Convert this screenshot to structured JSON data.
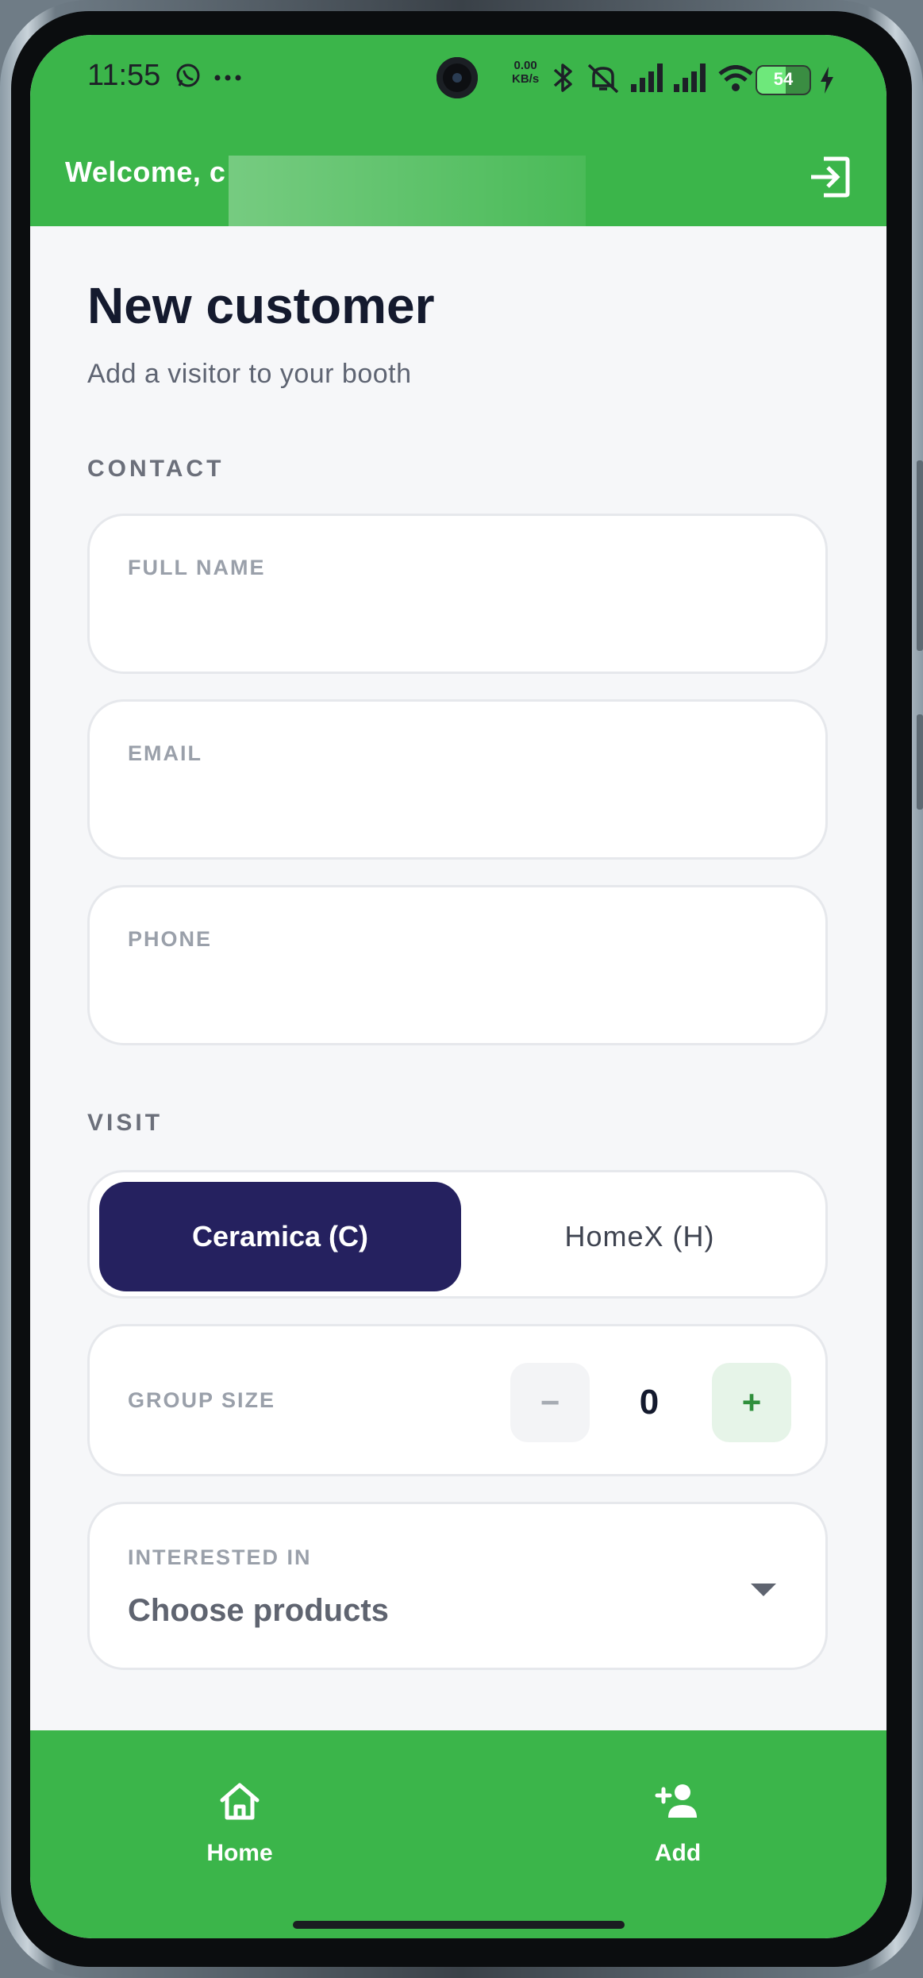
{
  "status_bar": {
    "time": "11:55",
    "net_speed_value": "0.00",
    "net_speed_unit": "KB/s",
    "battery_level": "54",
    "icons": [
      "whatsapp-icon",
      "more-icon",
      "bluetooth-icon",
      "mute-icon",
      "signal-icon",
      "signal-icon",
      "wifi-icon",
      "battery-icon",
      "charging-icon"
    ]
  },
  "header": {
    "welcome_text": "Welcome, c",
    "logout_icon": "logout-icon"
  },
  "page": {
    "title": "New customer",
    "subtitle": "Add a visitor to your booth"
  },
  "contact": {
    "section_label": "CONTACT",
    "full_name_label": "FULL NAME",
    "full_name_value": "",
    "email_label": "EMAIL",
    "email_value": "",
    "phone_label": "PHONE",
    "phone_value": ""
  },
  "visit": {
    "section_label": "VISIT",
    "options": [
      {
        "label": "Ceramica (C)",
        "selected": true
      },
      {
        "label": "HomeX (H)",
        "selected": false
      }
    ],
    "group_size_label": "GROUP SIZE",
    "group_size_value": "0",
    "decrement_symbol": "−",
    "increment_symbol": "+",
    "interested_label": "INTERESTED IN",
    "interested_value": "Choose products"
  },
  "bottom_nav": {
    "items": [
      {
        "label": "Home",
        "icon": "home-icon"
      },
      {
        "label": "Add",
        "icon": "add-person-icon"
      }
    ]
  },
  "colors": {
    "brand_green": "#3bb54a",
    "accent_navy": "#25215f",
    "background": "#f6f7f9"
  }
}
